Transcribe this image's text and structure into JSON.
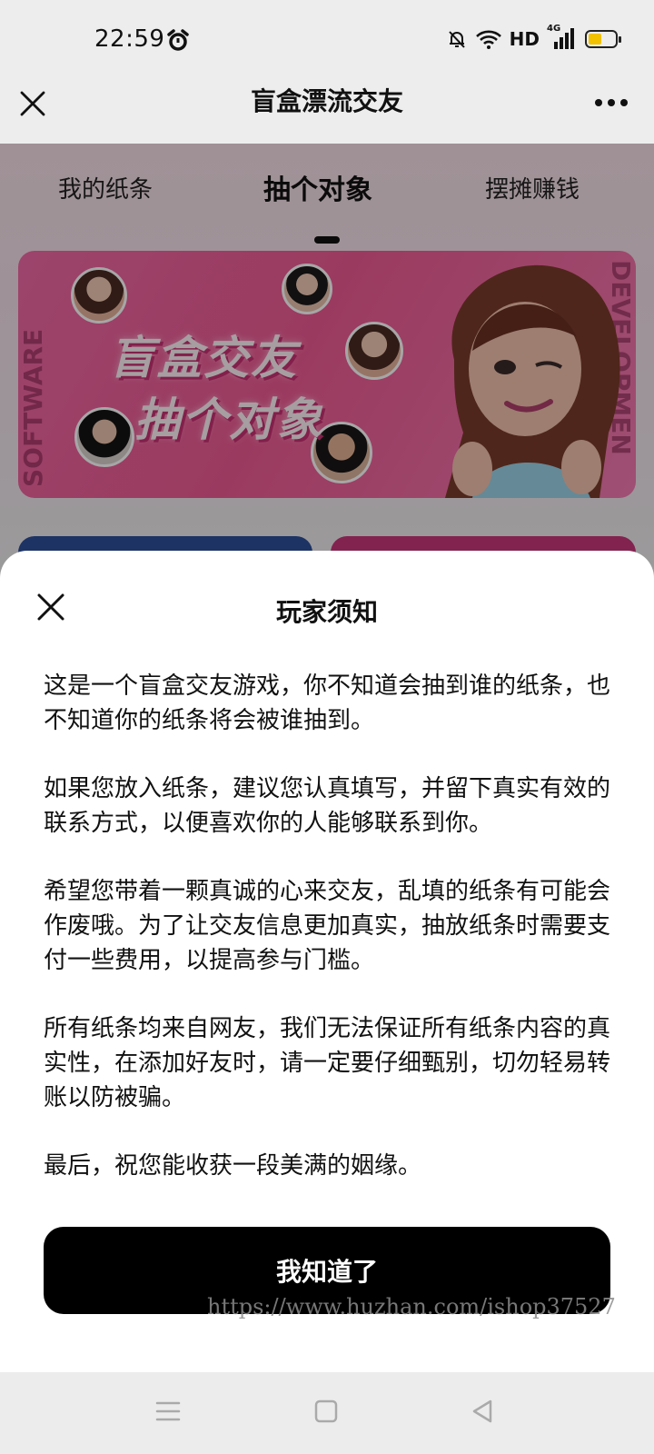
{
  "status_bar": {
    "time": "22:59",
    "network_label": "HD",
    "signal_label": "4G"
  },
  "nav": {
    "title": "盲盒漂流交友"
  },
  "tabs": [
    {
      "label": "我的纸条"
    },
    {
      "label": "抽个对象"
    },
    {
      "label": "摆摊赚钱"
    }
  ],
  "banner": {
    "line1": "盲盒交友",
    "line2": "抽个对象",
    "side_left": "SOFTWARE",
    "side_right": "DEVELOPMEN"
  },
  "sheet": {
    "title": "玩家须知",
    "paragraphs": [
      "这是一个盲盒交友游戏，你不知道会抽到谁的纸条，也不知道你的纸条将会被谁抽到。",
      "如果您放入纸条，建议您认真填写，并留下真实有效的联系方式，以便喜欢你的人能够联系到你。",
      "希望您带着一颗真诚的心来交友，乱填的纸条有可能会作废哦。为了让交友信息更加真实，抽放纸条时需要支付一些费用，以提高参与门槛。",
      "所有纸条均来自网友，我们无法保证所有纸条内容的真实性，在添加好友时，请一定要仔细甄别，切勿轻易转账以防被骗。",
      "最后，祝您能收获一段美满的姻缘。"
    ],
    "confirm_label": "我知道了"
  },
  "watermark": "https://www.huzhan.com/ishop37527",
  "colors": {
    "accent_pink": "#ef5a93",
    "button_bg": "#000000",
    "battery": "#f2c200"
  },
  "battery_level": 0.45
}
